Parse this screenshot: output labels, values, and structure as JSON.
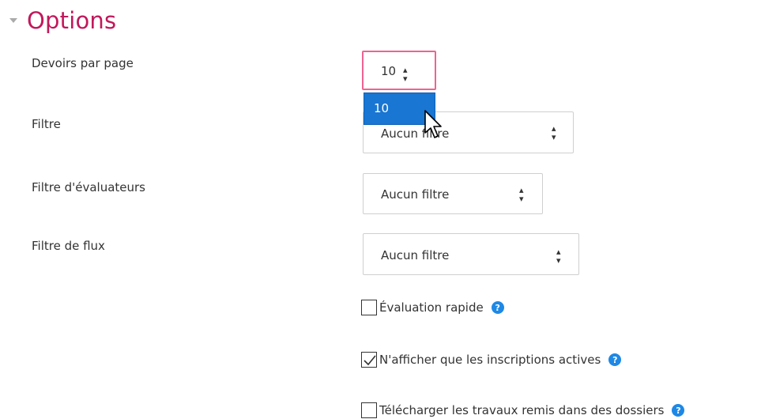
{
  "section": {
    "title": "Options"
  },
  "fields": {
    "per_page": {
      "label": "Devoirs par page",
      "value": "10"
    },
    "filter": {
      "label": "Filtre",
      "value": "Aucun filtre"
    },
    "marker_filter": {
      "label": "Filtre d'évaluateurs",
      "value": "Aucun filtre"
    },
    "workflow_filter": {
      "label": "Filtre de flux",
      "value": "Aucun filtre"
    }
  },
  "dropdown": {
    "highlighted_option": "10"
  },
  "checkboxes": {
    "quick_grading": {
      "label": "Évaluation rapide",
      "checked": false
    },
    "active_only": {
      "label": "N'afficher que les inscriptions actives",
      "checked": true
    },
    "download_folders": {
      "label": "Télécharger les travaux remis dans des dossiers",
      "checked": false
    }
  },
  "colors": {
    "accent": "#c2185b",
    "focus_border": "#f06292",
    "highlight": "#1976d2",
    "help": "#1e88e5"
  },
  "icons": [
    "collapse-icon",
    "select-arrow-icon",
    "mouse-pointer-icon",
    "help-icon",
    "check-icon"
  ]
}
